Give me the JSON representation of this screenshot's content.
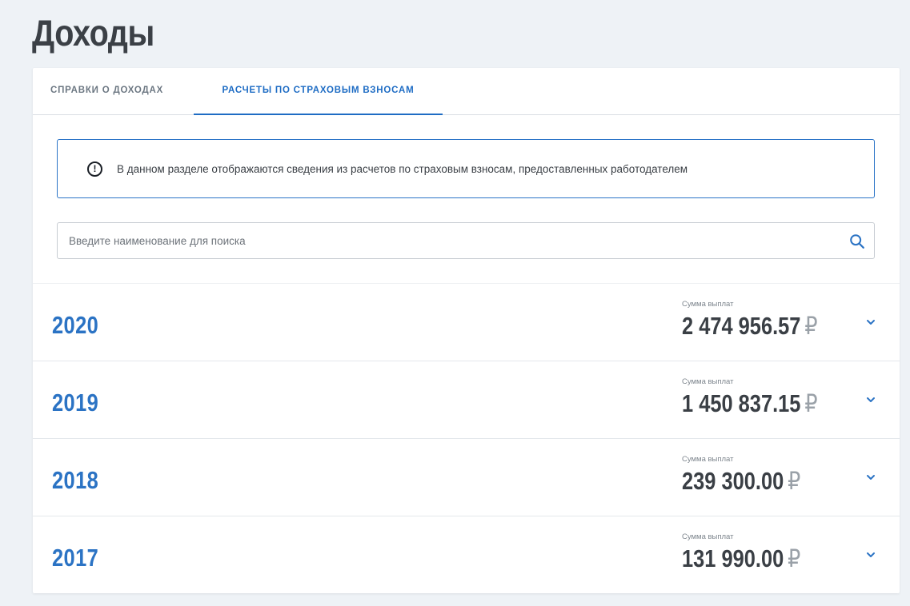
{
  "page": {
    "title": "Доходы"
  },
  "tabs": [
    {
      "label": "СПРАВКИ О ДОХОДАХ",
      "active": false
    },
    {
      "label": "РАСЧЕТЫ ПО СТРАХОВЫМ ВЗНОСАМ",
      "active": true
    }
  ],
  "info": {
    "text": "В данном разделе отображаются сведения из расчетов по страховым взносам, предоставленных работодателем",
    "icon": "exclamation-circle-icon"
  },
  "search": {
    "placeholder": "Введите наименование для поиска",
    "value": "",
    "icon": "search-icon"
  },
  "years": [
    {
      "year": "2020",
      "sum_label": "Сумма выплат",
      "sum": "2 474 956.57",
      "currency": "₽"
    },
    {
      "year": "2019",
      "sum_label": "Сумма выплат",
      "sum": "1 450 837.15",
      "currency": "₽"
    },
    {
      "year": "2018",
      "sum_label": "Сумма выплат",
      "sum": "239 300.00",
      "currency": "₽"
    },
    {
      "year": "2017",
      "sum_label": "Сумма выплат",
      "sum": "131 990.00",
      "currency": "₽"
    }
  ],
  "colors": {
    "accent": "#1e6cc4",
    "year": "#2b73c4",
    "text": "#3a3f45",
    "background": "#eef2f6"
  }
}
